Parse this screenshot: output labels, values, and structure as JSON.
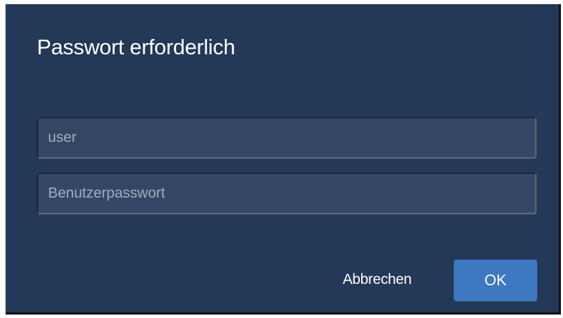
{
  "dialog": {
    "title": "Passwort erforderlich",
    "username": {
      "value": "",
      "placeholder": "user"
    },
    "password": {
      "value": "",
      "placeholder": "Benutzerpasswort"
    },
    "cancel_label": "Abbrechen",
    "ok_label": "OK"
  },
  "colors": {
    "dialog_background": "#243858",
    "input_background": "#364766",
    "primary_button": "#3d78c0",
    "text": "#ffffff"
  }
}
